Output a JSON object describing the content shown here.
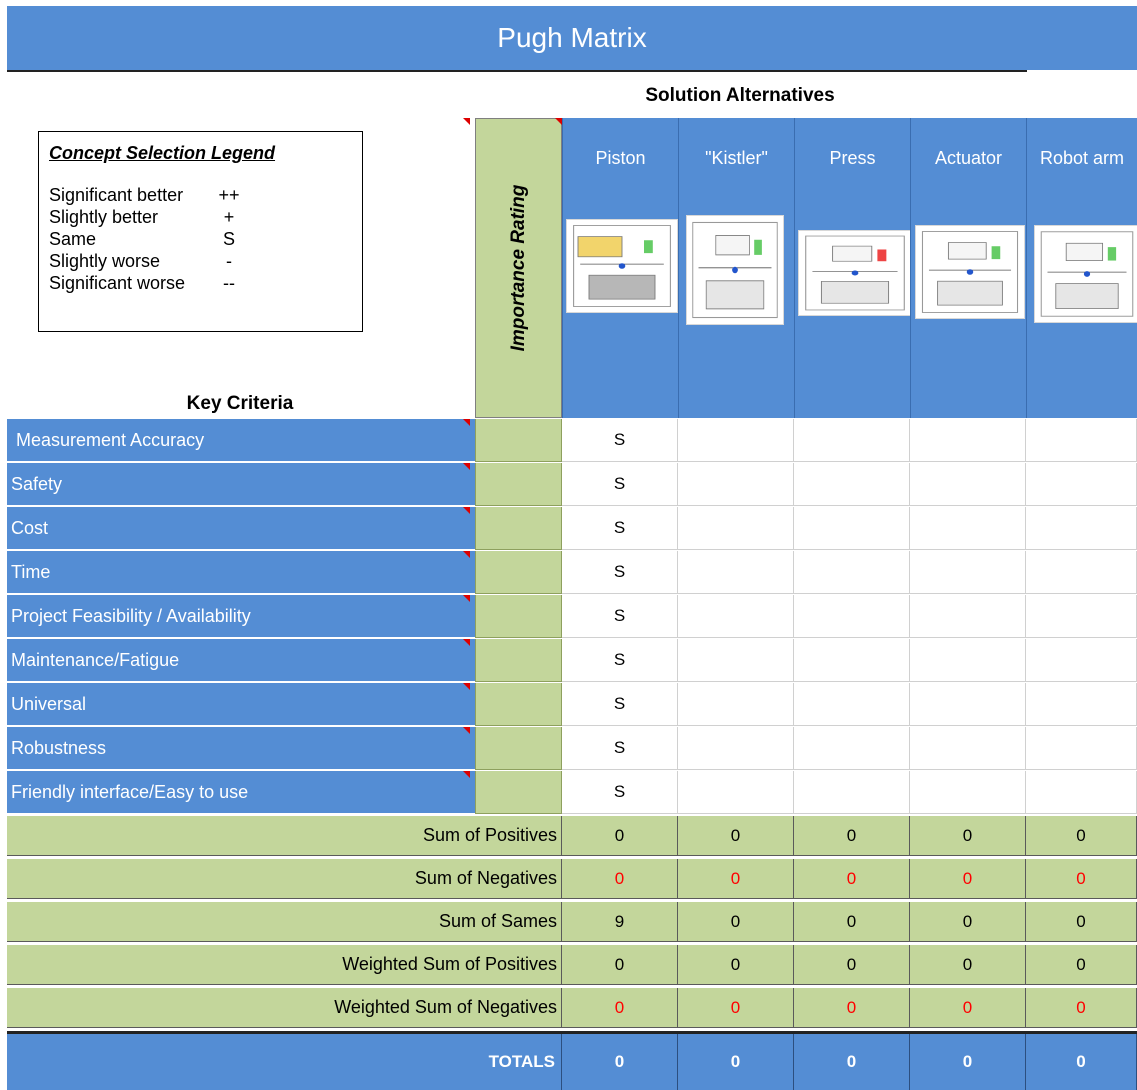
{
  "title": "Pugh Matrix",
  "solution_alternatives_label": "Solution Alternatives",
  "legend": {
    "title": "Concept Selection Legend",
    "items": [
      {
        "text": "Significant better",
        "symbol": "++"
      },
      {
        "text": "Slightly better",
        "symbol": "+"
      },
      {
        "text": "Same",
        "symbol": "S"
      },
      {
        "text": "Slightly worse",
        "symbol": "-"
      },
      {
        "text": "Significant worse",
        "symbol": "--"
      }
    ]
  },
  "key_criteria_label": "Key Criteria",
  "importance_label": "Importance Rating",
  "alternatives": [
    {
      "name": "Piston",
      "image": "piston-diagram"
    },
    {
      "name": "\"Kistler\"",
      "image": "kistler-diagram"
    },
    {
      "name": "Press",
      "image": "press-diagram"
    },
    {
      "name": "Actuator",
      "image": "actuator-diagram"
    },
    {
      "name": "Robot arm",
      "image": "robot-arm-diagram"
    }
  ],
  "criteria": [
    {
      "label": " Measurement Accuracy",
      "values": [
        "S",
        "",
        "",
        "",
        ""
      ]
    },
    {
      "label": "Safety",
      "values": [
        "S",
        "",
        "",
        "",
        ""
      ]
    },
    {
      "label": "Cost",
      "values": [
        "S",
        "",
        "",
        "",
        ""
      ]
    },
    {
      "label": "Time",
      "values": [
        "S",
        "",
        "",
        "",
        ""
      ]
    },
    {
      "label": "Project Feasibility / Availability",
      "values": [
        "S",
        "",
        "",
        "",
        ""
      ]
    },
    {
      "label": "Maintenance/Fatigue",
      "values": [
        "S",
        "",
        "",
        "",
        ""
      ]
    },
    {
      "label": "Universal",
      "values": [
        "S",
        "",
        "",
        "",
        ""
      ]
    },
    {
      "label": "Robustness",
      "values": [
        "S",
        "",
        "",
        "",
        ""
      ]
    },
    {
      "label": "Friendly interface/Easy to use",
      "values": [
        "S",
        "",
        "",
        "",
        ""
      ]
    }
  ],
  "summary": [
    {
      "label": "Sum of Positives",
      "values": [
        "0",
        "0",
        "0",
        "0",
        "0"
      ],
      "color": "#000000"
    },
    {
      "label": "Sum of Negatives",
      "values": [
        "0",
        "0",
        "0",
        "0",
        "0"
      ],
      "color": "#ff0000"
    },
    {
      "label": "Sum of Sames",
      "values": [
        "9",
        "0",
        "0",
        "0",
        "0"
      ],
      "color": "#000000"
    },
    {
      "label": "Weighted Sum of Positives",
      "values": [
        "0",
        "0",
        "0",
        "0",
        "0"
      ],
      "color": "#000000"
    },
    {
      "label": "Weighted Sum of Negatives",
      "values": [
        "0",
        "0",
        "0",
        "0",
        "0"
      ],
      "color": "#ff0000"
    }
  ],
  "totals": {
    "label": "TOTALS",
    "values": [
      "0",
      "0",
      "0",
      "0",
      "0"
    ]
  },
  "colors": {
    "header_blue": "#548dd4",
    "green": "#c3d69b",
    "negative_red": "#ff0000"
  }
}
